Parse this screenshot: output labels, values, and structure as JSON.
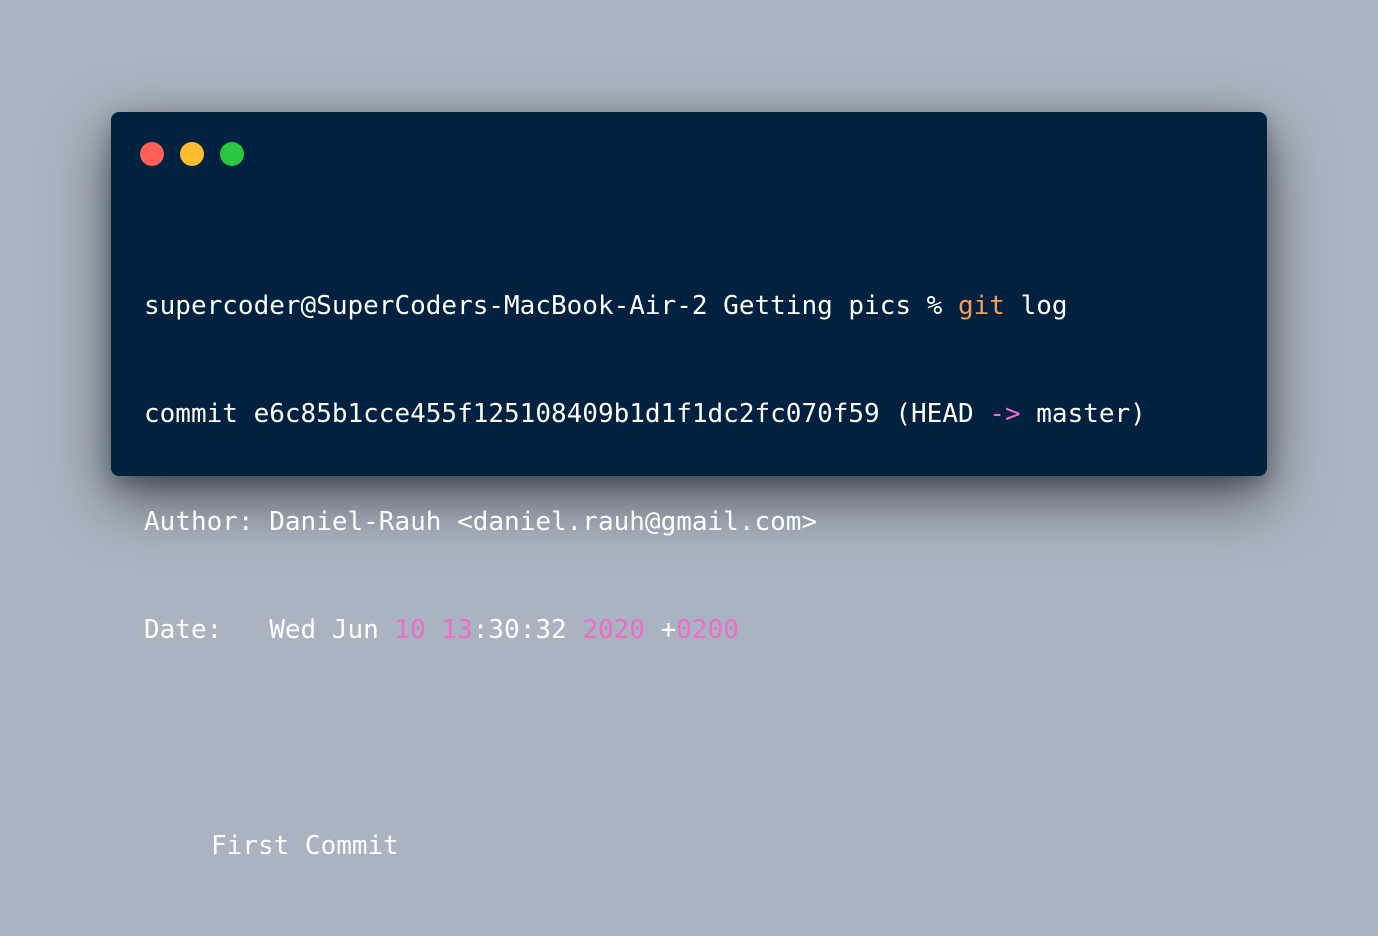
{
  "window": {
    "controls": [
      {
        "name": "close",
        "color": "#ff5f57"
      },
      {
        "name": "minimize",
        "color": "#febc2e"
      },
      {
        "name": "zoom",
        "color": "#28c840"
      }
    ]
  },
  "terminal": {
    "prompt": {
      "user_host_dir": "supercoder@SuperCoders-MacBook-Air-2 Getting pics % ",
      "command": "git",
      "args": " log"
    },
    "commit": {
      "label": "commit ",
      "hash": "e6c85b1cce455f125108409b1d1f1dc2fc070f59",
      "ref_open": " (HEAD ",
      "arrow": "->",
      "ref_close": " master)"
    },
    "author": {
      "label": "Author: ",
      "value": "Daniel-Rauh <daniel.rauh@gmail.com>"
    },
    "date": {
      "label": "Date:   ",
      "weekday_month": "Wed Jun ",
      "day": "10",
      "space1": " ",
      "hour": "13",
      "min_sec": ":30:32 ",
      "year": "2020",
      "tz_sign": " +",
      "tz": "0200"
    },
    "message": "First Commit"
  }
}
